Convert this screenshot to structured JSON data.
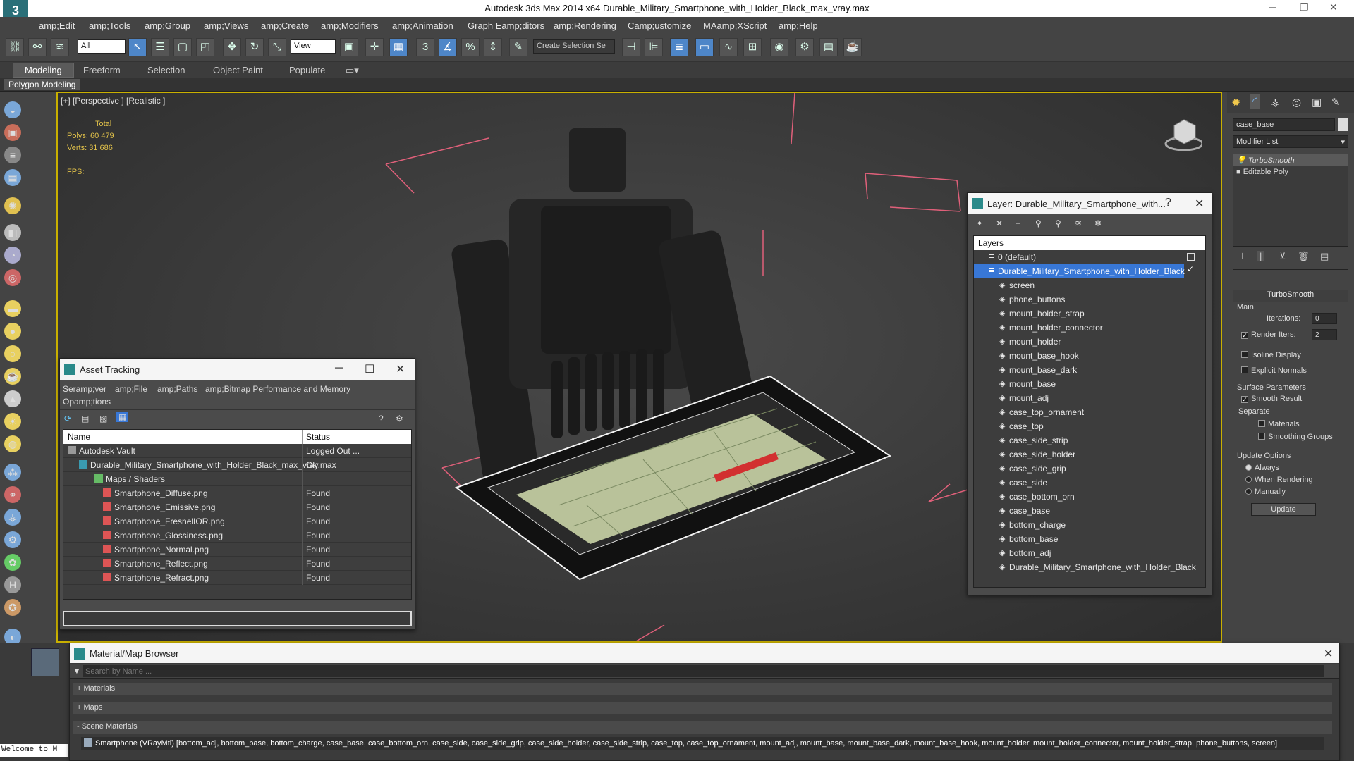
{
  "app": {
    "title": "Autodesk 3ds Max  2014 x64     Durable_Military_Smartphone_with_Holder_Black_max_vray.max"
  },
  "menu": [
    "amp;Edit",
    "amp;Tools",
    "amp;Group",
    "amp;Views",
    "amp;Create",
    "amp;Modifiers",
    "amp;Animation",
    "Graph Eamp;ditors",
    "amp;Rendering",
    "Camp;ustomize",
    "MAamp;XScript",
    "amp;Help"
  ],
  "toolbar": {
    "selection_filter": "All",
    "ref_coord": "View",
    "named_selection": "Create Selection Se"
  },
  "ribbon": {
    "tabs": [
      "Modeling",
      "Freeform",
      "Selection",
      "Object Paint",
      "Populate"
    ],
    "active": "Modeling",
    "sub": "Polygon Modeling"
  },
  "viewport": {
    "label": "[+] [Perspective ] [Realistic ]",
    "stats_header": "Total",
    "polys_label": "Polys:",
    "polys_value": "60 479",
    "verts_label": "Verts:",
    "verts_value": "31 686",
    "fps_label": "FPS:"
  },
  "asset_tracking": {
    "title": "Asset Tracking",
    "menu": [
      "Seramp;ver",
      "amp;File",
      "amp;Paths",
      "amp;Bitmap Performance and Memory",
      "Opamp;tions"
    ],
    "columns": [
      "Name",
      "Status"
    ],
    "rows": [
      {
        "name": "Autodesk Vault",
        "status": "Logged Out ..."
      },
      {
        "name": "Durable_Military_Smartphone_with_Holder_Black_max_vray.max",
        "status": "Ok"
      },
      {
        "name": "Maps / Shaders",
        "status": ""
      },
      {
        "name": "Smartphone_Diffuse.png",
        "status": "Found"
      },
      {
        "name": "Smartphone_Emissive.png",
        "status": "Found"
      },
      {
        "name": "Smartphone_FresnelIOR.png",
        "status": "Found"
      },
      {
        "name": "Smartphone_Glossiness.png",
        "status": "Found"
      },
      {
        "name": "Smartphone_Normal.png",
        "status": "Found"
      },
      {
        "name": "Smartphone_Reflect.png",
        "status": "Found"
      },
      {
        "name": "Smartphone_Refract.png",
        "status": "Found"
      }
    ]
  },
  "layer_dialog": {
    "title": "Layer: Durable_Military_Smartphone_with...",
    "header": "Layers",
    "layers": [
      {
        "name": "0 (default)",
        "level": 0
      },
      {
        "name": "Durable_Military_Smartphone_with_Holder_Black",
        "level": 0,
        "selected": true
      },
      {
        "name": "screen",
        "level": 1
      },
      {
        "name": "phone_buttons",
        "level": 1
      },
      {
        "name": "mount_holder_strap",
        "level": 1
      },
      {
        "name": "mount_holder_connector",
        "level": 1
      },
      {
        "name": "mount_holder",
        "level": 1
      },
      {
        "name": "mount_base_hook",
        "level": 1
      },
      {
        "name": "mount_base_dark",
        "level": 1
      },
      {
        "name": "mount_base",
        "level": 1
      },
      {
        "name": "mount_adj",
        "level": 1
      },
      {
        "name": "case_top_ornament",
        "level": 1
      },
      {
        "name": "case_top",
        "level": 1
      },
      {
        "name": "case_side_strip",
        "level": 1
      },
      {
        "name": "case_side_holder",
        "level": 1
      },
      {
        "name": "case_side_grip",
        "level": 1
      },
      {
        "name": "case_side",
        "level": 1
      },
      {
        "name": "case_bottom_orn",
        "level": 1
      },
      {
        "name": "case_base",
        "level": 1
      },
      {
        "name": "bottom_charge",
        "level": 1
      },
      {
        "name": "bottom_base",
        "level": 1
      },
      {
        "name": "bottom_adj",
        "level": 1
      },
      {
        "name": "Durable_Military_Smartphone_with_Holder_Black",
        "level": 1
      }
    ]
  },
  "command_panel": {
    "object_name": "case_base",
    "modifier_list": "Modifier List",
    "stack": [
      "TurboSmooth",
      "Editable Poly"
    ],
    "rollout_title": "TurboSmooth",
    "main_label": "Main",
    "iterations_label": "Iterations:",
    "iterations_value": "0",
    "render_iters_label": "Render Iters:",
    "render_iters_value": "2",
    "isoline_label": "Isoline Display",
    "explicit_label": "Explicit Normals",
    "surface_label": "Surface Parameters",
    "smooth_label": "Smooth Result",
    "separate_label": "Separate",
    "materials_label": "Materials",
    "smoothing_label": "Smoothing Groups",
    "update_options_label": "Update Options",
    "always_label": "Always",
    "when_rendering_label": "When Rendering",
    "manually_label": "Manually",
    "update_button": "Update"
  },
  "material_browser": {
    "title": "Material/Map Browser",
    "search_placeholder": "Search by Name ...",
    "groups": [
      "+ Materials",
      "+ Maps",
      "- Scene Materials"
    ],
    "scene_material": "Smartphone (VRayMtl) [bottom_adj, bottom_base, bottom_charge, case_base, case_bottom_orn, case_side, case_side_grip, case_side_holder, case_side_strip, case_top, case_top_ornament, mount_adj, mount_base, mount_base_dark, mount_base_hook, mount_holder, mount_holder_connector, mount_holder_strap, phone_buttons, screen]"
  },
  "status": {
    "welcome": "Welcome to M"
  },
  "colors": {
    "selection": "#3877d6",
    "viewport_border": "#c9b000",
    "stats_text": "#e2c24a",
    "bbox_lines": "#e0607a"
  }
}
